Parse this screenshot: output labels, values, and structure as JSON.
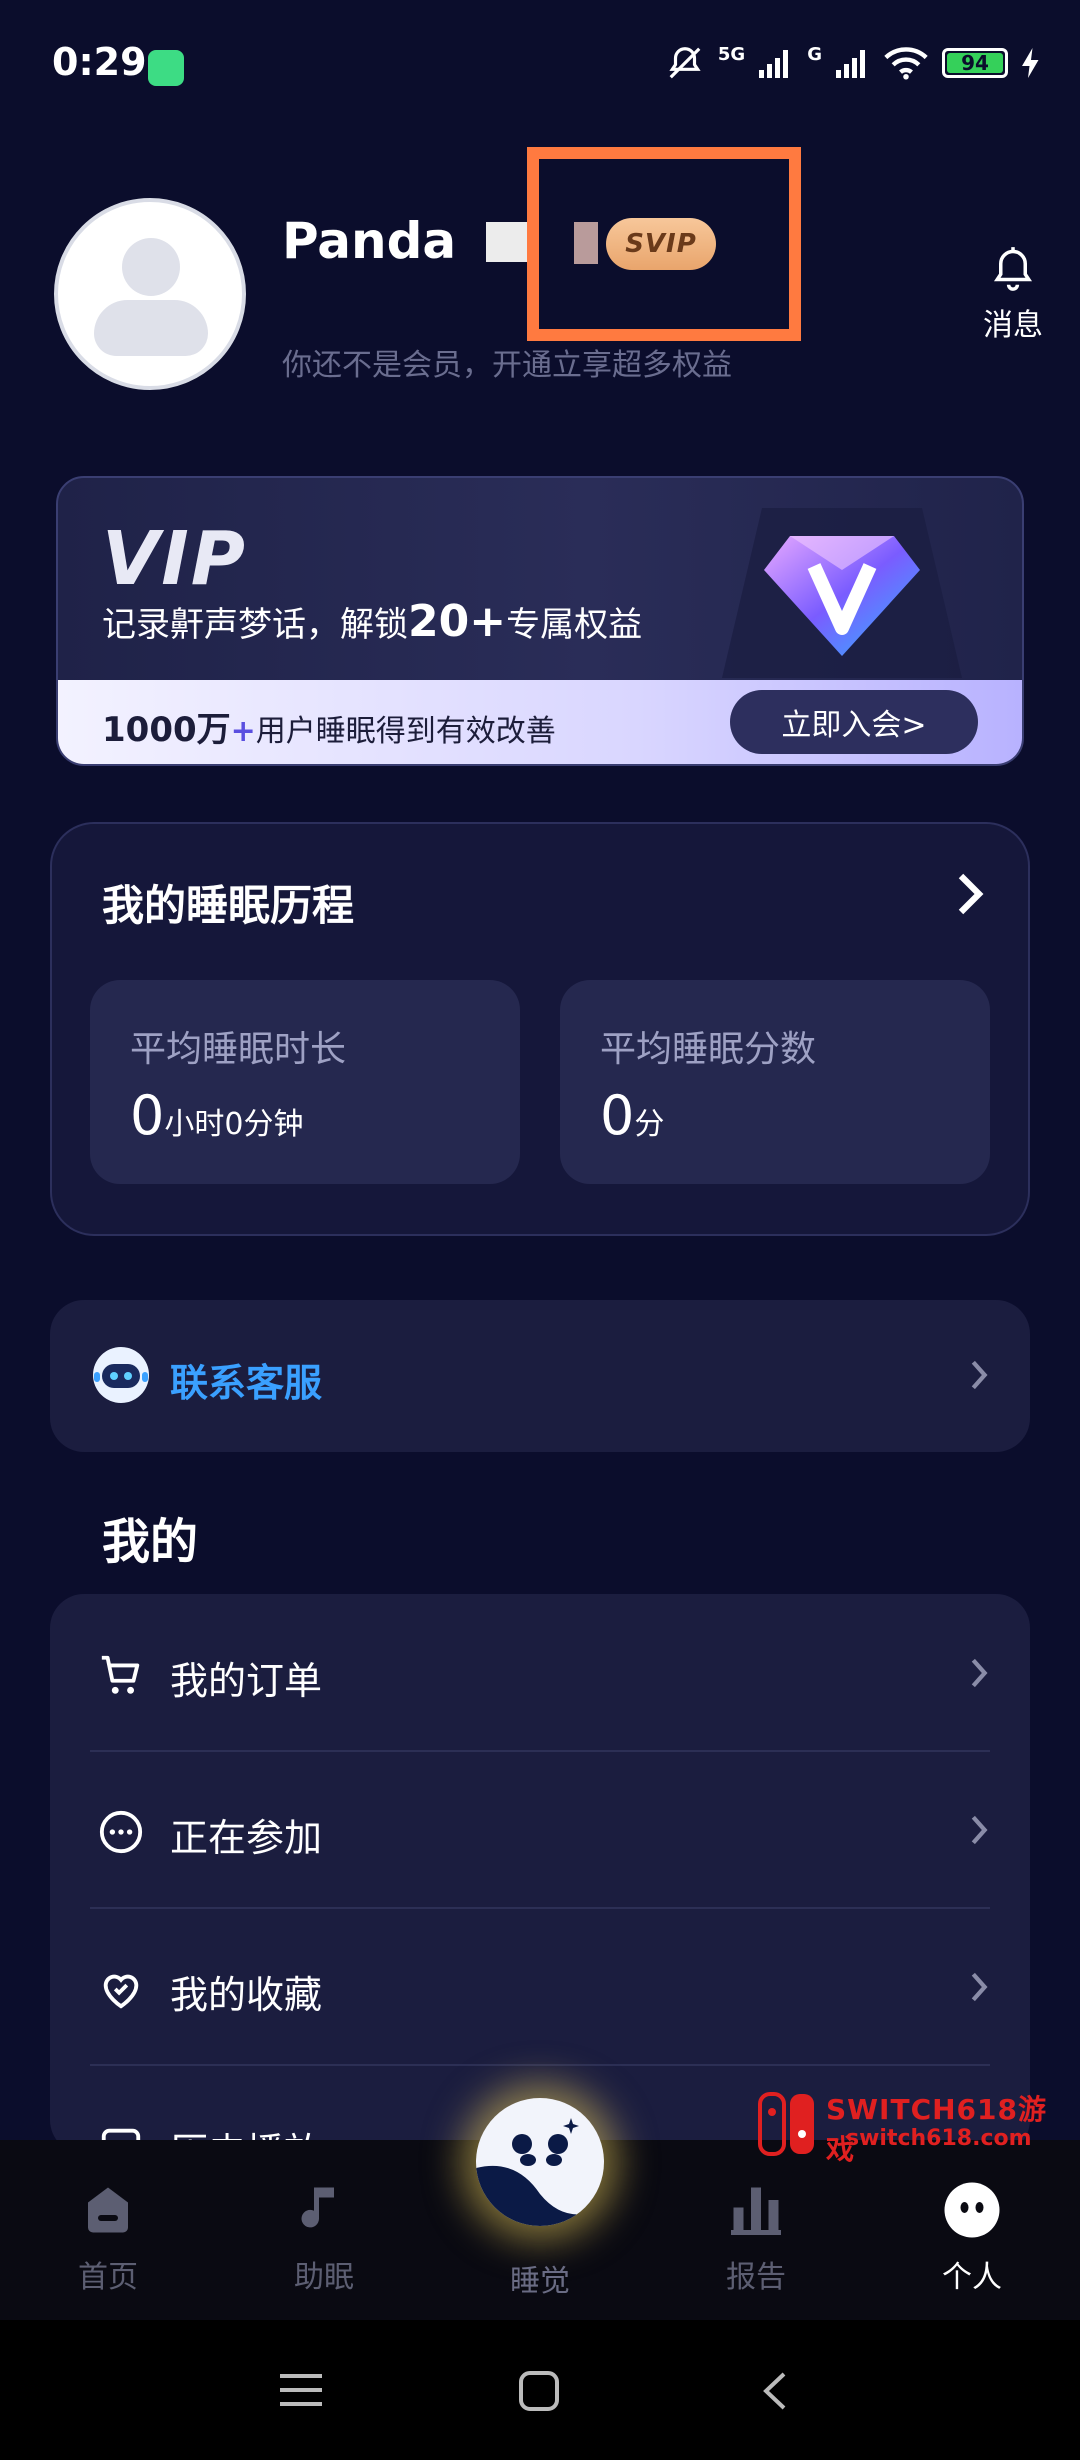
{
  "status_bar": {
    "time": "0:29",
    "network_1": "5G",
    "network_2": "G",
    "battery": "94"
  },
  "profile": {
    "username": "Panda",
    "badge": "SVIP",
    "subtitle": "你还不是会员，开通立享超多权益",
    "notifications_label": "消息"
  },
  "vip_card": {
    "title": "VIP",
    "desc_prefix": "记录鼾声梦话，解锁",
    "desc_number": "20+",
    "desc_suffix": "专属权益",
    "bottom_big": "1000万",
    "bottom_plus": "+",
    "bottom_text": "用户睡眠得到有效改善",
    "join_button": "立即入会>"
  },
  "sleep_history": {
    "title": "我的睡眠历程",
    "stats": [
      {
        "label": "平均睡眠时长",
        "value": "0",
        "unit": "小时0分钟"
      },
      {
        "label": "平均睡眠分数",
        "value": "0",
        "unit": "分"
      }
    ]
  },
  "support": {
    "label": "联系客服"
  },
  "my_section": {
    "title": "我的",
    "items": [
      {
        "label": "我的订单",
        "icon": "cart-icon"
      },
      {
        "label": "正在参加",
        "icon": "more-circle-icon"
      },
      {
        "label": "我的收藏",
        "icon": "heart-icon"
      },
      {
        "label": "历史播放",
        "icon": "history-icon"
      }
    ]
  },
  "bottom_nav": {
    "items": [
      {
        "label": "首页",
        "active": false
      },
      {
        "label": "助眠",
        "active": false
      },
      {
        "label": "睡觉",
        "active": false
      },
      {
        "label": "报告",
        "active": false
      },
      {
        "label": "个人",
        "active": true
      }
    ]
  },
  "watermark": {
    "title": "SWITCH618游戏",
    "url": "switch618.com"
  },
  "colors": {
    "background": "#0b0d2c",
    "accent_blue": "#3aa0ff",
    "highlight": "#ff7a40",
    "svip_gold": "#e9a56c"
  }
}
